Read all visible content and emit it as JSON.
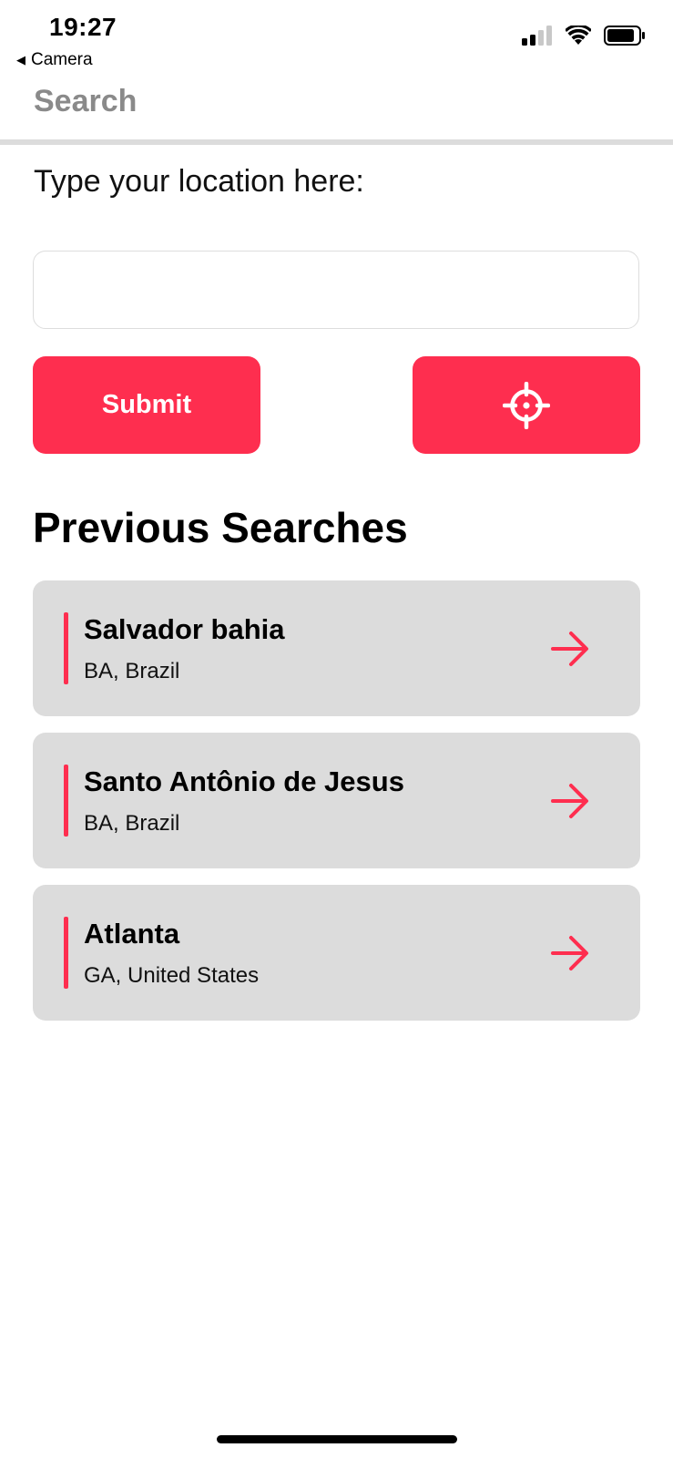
{
  "status_bar": {
    "time": "19:27",
    "back_label": "Camera",
    "icons": [
      "cellular-signal-icon",
      "wifi-icon",
      "battery-icon"
    ]
  },
  "nav": {
    "title": "Search"
  },
  "search": {
    "prompt": "Type your location here:",
    "input_value": "",
    "placeholder": "",
    "submit_label": "Submit",
    "locate_icon": "crosshair-icon"
  },
  "history": {
    "title": "Previous Searches",
    "items": [
      {
        "city": "Salvador bahia",
        "region": "BA, Brazil"
      },
      {
        "city": "Santo Antônio de Jesus",
        "region": "BA, Brazil"
      },
      {
        "city": "Atlanta",
        "region": "GA, United States"
      }
    ]
  },
  "colors": {
    "accent": "#fe2e4f",
    "card_background": "#dcdcdc",
    "nav_title": "#8a8a8a"
  }
}
